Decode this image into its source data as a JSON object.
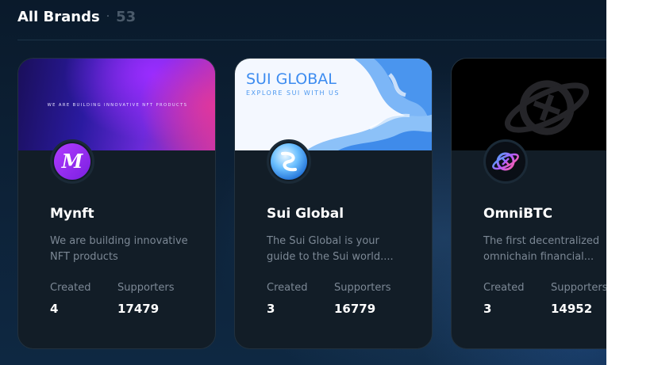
{
  "header": {
    "title": "All Brands",
    "separator": "·",
    "count": "53"
  },
  "cards": [
    {
      "name": "Mynft",
      "description": "We are building innovative NFT products",
      "banner_text": "WE ARE BUILDING INNOVATIVE NFT PRODUCTS",
      "avatar_letter": "M",
      "created_label": "Created",
      "supporters_label": "Supporters",
      "created": "4",
      "supporters": "17479"
    },
    {
      "name": "Sui Global",
      "description": "The Sui Global is your guide to the Sui world....",
      "banner_title": "SUI GLOBAL",
      "banner_subtitle": "EXPLORE SUI WITH US",
      "created_label": "Created",
      "supporters_label": "Supporters",
      "created": "3",
      "supporters": "16779"
    },
    {
      "name": "OmniBTC",
      "description": "The first decentralized omnichain financial...",
      "created_label": "Created",
      "supporters_label": "Supporters",
      "created": "3",
      "supporters": "14952"
    }
  ],
  "colors": {
    "background": "#0d2238",
    "card": "#121d27",
    "muted_text": "#7c8895",
    "accent_purple": "#8a2be2",
    "sui_blue": "#3d8cf0"
  }
}
